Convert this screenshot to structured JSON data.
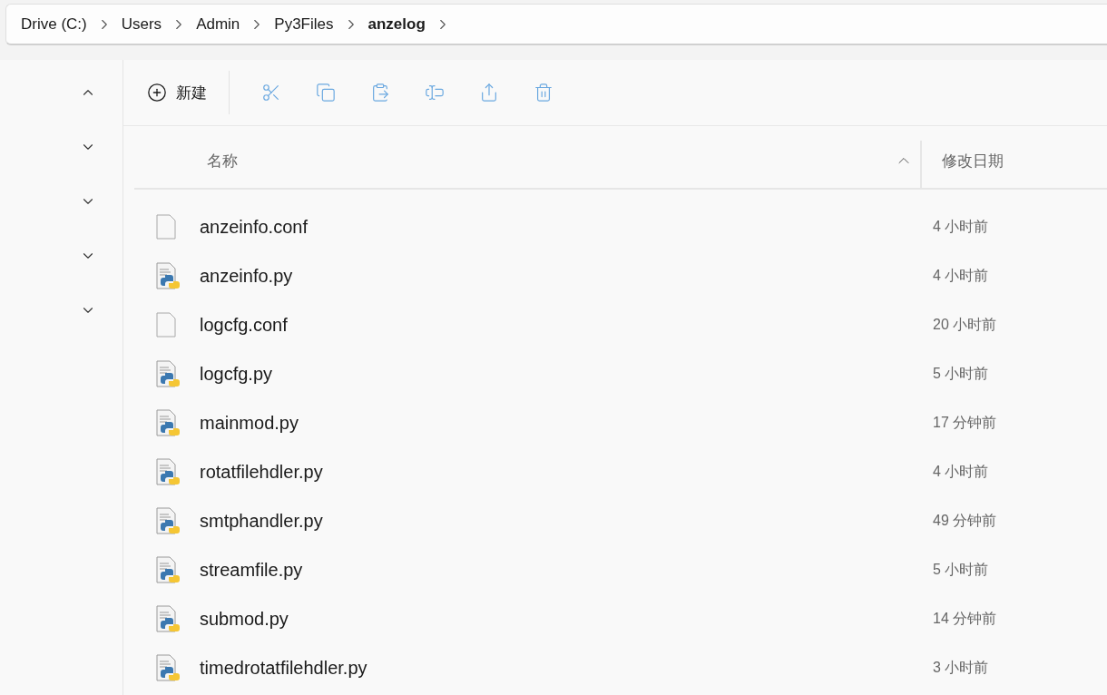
{
  "breadcrumb": [
    {
      "text": "Drive (C:)",
      "current": false
    },
    {
      "text": "Users",
      "current": false
    },
    {
      "text": "Admin",
      "current": false
    },
    {
      "text": "Py3Files",
      "current": false
    },
    {
      "text": "anzelog",
      "current": true
    }
  ],
  "sidebar": {
    "items": [
      {
        "expanded": true
      },
      {
        "expanded": false
      },
      {
        "expanded": false
      },
      {
        "expanded": false
      },
      {
        "expanded": false
      }
    ]
  },
  "toolbar": {
    "new_button": "新建",
    "actions": [
      {
        "kind": "cut"
      },
      {
        "kind": "copy"
      },
      {
        "kind": "paste"
      },
      {
        "kind": "rename"
      },
      {
        "kind": "share"
      },
      {
        "kind": "delete"
      }
    ]
  },
  "table": {
    "columns": [
      {
        "label": "名称",
        "sorted": true
      },
      {
        "label": "修改日期",
        "sorted": false
      }
    ],
    "rows": [
      {
        "name": "anzeinfo.conf",
        "kind": "text",
        "modified": "4 小时前"
      },
      {
        "name": "anzeinfo.py",
        "kind": "python",
        "modified": "4 小时前"
      },
      {
        "name": "logcfg.conf",
        "kind": "text",
        "modified": "20 小时前"
      },
      {
        "name": "logcfg.py",
        "kind": "python",
        "modified": "5 小时前"
      },
      {
        "name": "mainmod.py",
        "kind": "python",
        "modified": "17 分钟前"
      },
      {
        "name": "rotatfilehdler.py",
        "kind": "python",
        "modified": "4 小时前"
      },
      {
        "name": "smtphandler.py",
        "kind": "python",
        "modified": "49 分钟前"
      },
      {
        "name": "streamfile.py",
        "kind": "python",
        "modified": "5 小时前"
      },
      {
        "name": "submod.py",
        "kind": "python",
        "modified": "14 分钟前"
      },
      {
        "name": "timedrotatfilehdler.py",
        "kind": "python",
        "modified": "3 小时前"
      }
    ]
  }
}
